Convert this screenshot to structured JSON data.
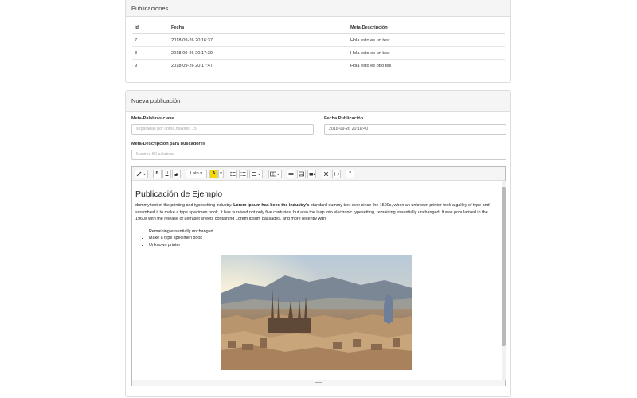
{
  "publications_panel": {
    "title": "Publicaciones",
    "columns": [
      "Id",
      "Fecha",
      "Meta-Descripción"
    ],
    "rows": [
      {
        "id": "7",
        "date": "2018-09-26 20:16:37",
        "meta": "Hola esto es un test"
      },
      {
        "id": "8",
        "date": "2018-09-26 20:17:39",
        "meta": "Hola esto es un test"
      },
      {
        "id": "9",
        "date": "2018-09-26 20:17:47",
        "meta": "Hola esto es otro tes"
      }
    ]
  },
  "new_publication": {
    "title": "Nueva publicación",
    "keywords_label": "Meta-Palabras clave",
    "keywords_placeholder": "separadas por coma,maximo 15",
    "date_label": "Fecha Publicación",
    "date_value": "2018-09-26 20:18:40",
    "description_label": "Meta-Descripción para buscadores",
    "description_placeholder": "Maximo 50 palabras"
  },
  "toolbar": {
    "font_name": "Lato",
    "icons": [
      "magic-icon",
      "bold-icon",
      "underline-icon",
      "eraser-icon",
      "font-color-icon",
      "unordered-list-icon",
      "ordered-list-icon",
      "align-icon",
      "table-icon",
      "link-icon",
      "picture-icon",
      "video-icon",
      "fullscreen-icon",
      "code-view-icon",
      "help-icon"
    ],
    "bold": "B",
    "underline": "U",
    "font_color": "A",
    "help": "?"
  },
  "editor_content": {
    "heading": "Publicación de Ejemplo",
    "para_start": "dummy text of the printing and typesetting industry. ",
    "para_bold": "Lorem Ipsum has been the industry's",
    "para_end": " standard dummy text ever since the 1500s, when an unknown printer took a galley of type and scrambled it to make a type specimen book. It has survived not only five centuries, but also the leap into electronic typesetting, remaining essentially unchanged. It was popularised in the 1960s with the release of Letraset sheets containing Lorem Ipsum passages, and more recently with",
    "bullets": [
      "Remaining essentially unchanged",
      "Make a type specimen book",
      "Unknown printer"
    ]
  },
  "colors": {
    "panel_heading_bg": "#f5f5f5",
    "border": "#dddddd",
    "font_color_button": "#f5d800"
  }
}
